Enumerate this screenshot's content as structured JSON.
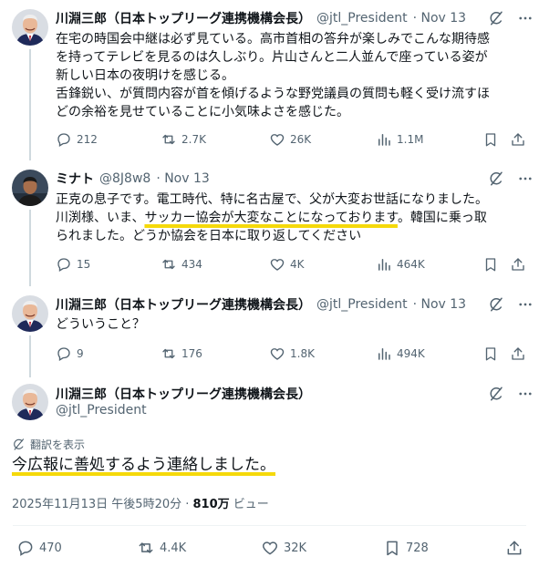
{
  "tweets": [
    {
      "name": "川淵三郎（日本トップリーグ連携機構会長）",
      "handle": "@jtl_President",
      "date": "· Nov 13",
      "lines": [
        "在宅の時国会中継は必ず見ている。高市首相の答弁が楽しみでこんな期待感",
        "を持ってテレビを見るのは久しぶり。片山さんと二人並んで座っている姿が",
        "新しい日本の夜明けを感じる。",
        "舌鋒鋭い、が質問内容が首を傾げるような野党議員の質問も軽く受け流すほ",
        "どの余裕を見せていることに小気味よさを感じた。"
      ],
      "replies": "212",
      "reposts": "2.7K",
      "likes": "26K",
      "views": "1.1M"
    },
    {
      "name": "ミナト",
      "handle": "@8J8w8",
      "date": "· Nov 13",
      "line1": "正克の息子です。電工時代、特に名古屋で、父が大変お世話になりました。",
      "line2_pre": "川渕様、いま、",
      "line2_hl": "サッカー協会が大変なことになっております",
      "line2_post": "。韓国に乗っ取",
      "line3": "られました。どうか協会を日本に取り返してください",
      "replies": "15",
      "reposts": "434",
      "likes": "4K",
      "views": "464K"
    },
    {
      "name": "川淵三郎（日本トップリーグ連携機構会長）",
      "handle": "@jtl_President",
      "date": "· Nov 13",
      "text": "どういうこと？",
      "replies": "9",
      "reposts": "176",
      "likes": "1.8K",
      "views": "494K"
    }
  ],
  "main": {
    "name": "川淵三郎（日本トップリーグ連携機構会長）",
    "handle": "@jtl_President",
    "translate": "翻訳を表示",
    "text": "今広報に善処するよう連絡しました。",
    "timestamp": "2025年11月13日 午後5時20分 · ",
    "views_count": "810万",
    "views_label": " ビュー",
    "replies": "470",
    "reposts": "4.4K",
    "likes": "32K",
    "bookmarks": "728"
  },
  "colors": {
    "highlight": "#f5d90a",
    "icon": "#536471",
    "text": "#0f1419",
    "line": "#cfd9de"
  }
}
